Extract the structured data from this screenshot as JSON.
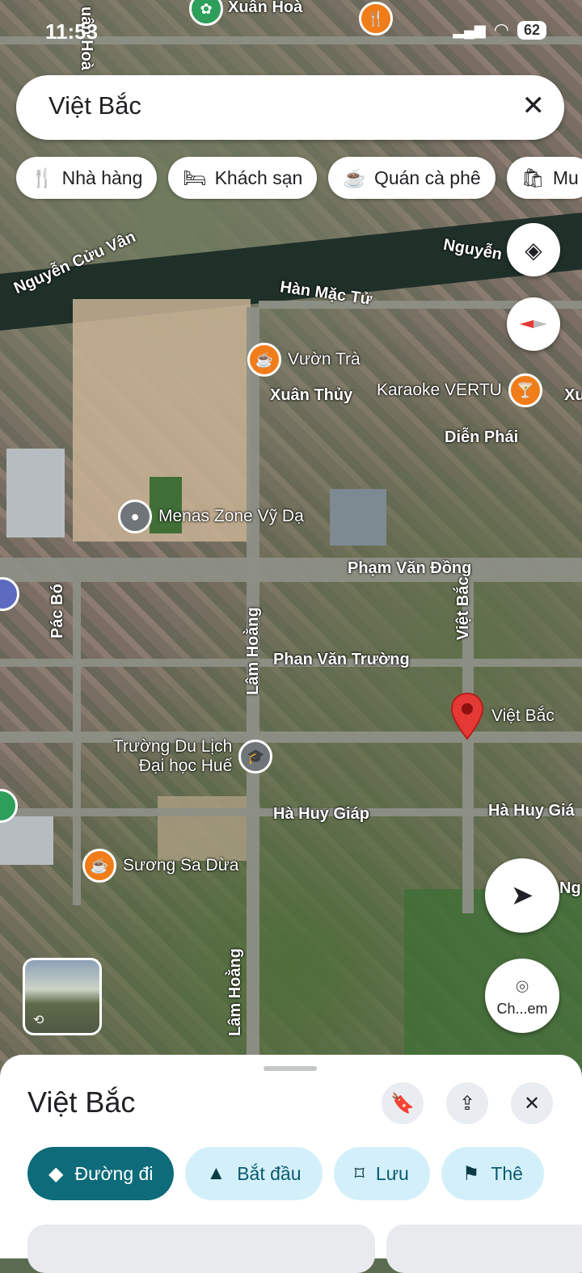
{
  "status": {
    "time": "11:53",
    "battery": "62"
  },
  "search": {
    "query": "Việt Bắc"
  },
  "chips": [
    {
      "icon": "restaurant-icon",
      "label": "Nhà hàng"
    },
    {
      "icon": "hotel-icon",
      "label": "Khách sạn"
    },
    {
      "icon": "coffee-icon",
      "label": "Quán cà phê"
    },
    {
      "icon": "shopping-icon",
      "label": "Mu"
    }
  ],
  "map": {
    "streets": {
      "xuan_hoa": "Xuân Hoà",
      "nguyen_cuu_van": "Nguyễn Cửu Vân",
      "nguyen_right": "Nguyễn",
      "han_mac_tu": "Hàn Mặc Tử",
      "xuan_thuy": "Xuân Thủy",
      "xu": "Xu",
      "dien_phai": "Diễn Phái",
      "pham_van_dong": "Phạm Văn Đồng",
      "pac_bo": "Pác Bó",
      "lam_hoang": "Lâm Hoằng",
      "viet_bac_vertical": "Việt Bắc",
      "phan_van_truong": "Phan Văn Trường",
      "ha_huy_giap": "Hà Huy Giáp",
      "ha_huy_gia_right": "Hà Huy Giá",
      "ng": "Ng",
      "lam_hoang_bottom": "Lâm Hoằng",
      "quan_hoa_partial": "uân Hoà"
    },
    "pois": {
      "vuon_tra": "Vườn Trà",
      "karaoke": "Karaoke VERTU",
      "menas": "Menas Zone Vỹ Dạ",
      "truong_line1": "Trường Du Lịch",
      "truong_line2": "Đại học Huế",
      "suong_sa": "Sương Sa Dừa",
      "pin_label": "Việt Bắc"
    },
    "camera_label": "Ch...em"
  },
  "sheet": {
    "title": "Việt Bắc",
    "actions": [
      {
        "icon": "directions-icon",
        "label": "Đường đi"
      },
      {
        "icon": "navigation-start-icon",
        "label": "Bắt đầu"
      },
      {
        "icon": "bookmark-icon",
        "label": "Lưu"
      },
      {
        "icon": "flag-icon",
        "label": "Thê"
      }
    ]
  },
  "colors": {
    "primary": "#0d6b7a",
    "chip_bg": "#d3f0fa",
    "pin": "#e53935",
    "poi_orange": "#f07d1a"
  }
}
